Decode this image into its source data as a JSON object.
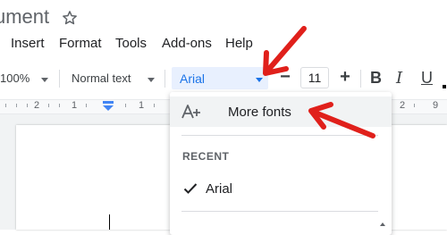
{
  "document": {
    "title": "ument"
  },
  "menu": [
    "Insert",
    "Format",
    "Tools",
    "Add-ons",
    "Help"
  ],
  "toolbar": {
    "zoom": "100%",
    "style": "Normal text",
    "font": "Arial",
    "size_decrease": "−",
    "font_size": "11",
    "size_increase": "+",
    "bold": "B",
    "italic": "I",
    "underline": "U"
  },
  "ruler": {
    "numbers": [
      "2",
      "1",
      "1",
      "2",
      "9"
    ]
  },
  "dropdown": {
    "more_fonts": "More fonts",
    "recent_header": "RECENT",
    "recent_fonts": [
      "Arial"
    ]
  },
  "colors": {
    "accent": "#1a73e8",
    "annotation_arrow": "#e0201b"
  },
  "icons": [
    "star-icon",
    "add-font-icon",
    "checkmark-icon",
    "chevron-up-icon"
  ]
}
